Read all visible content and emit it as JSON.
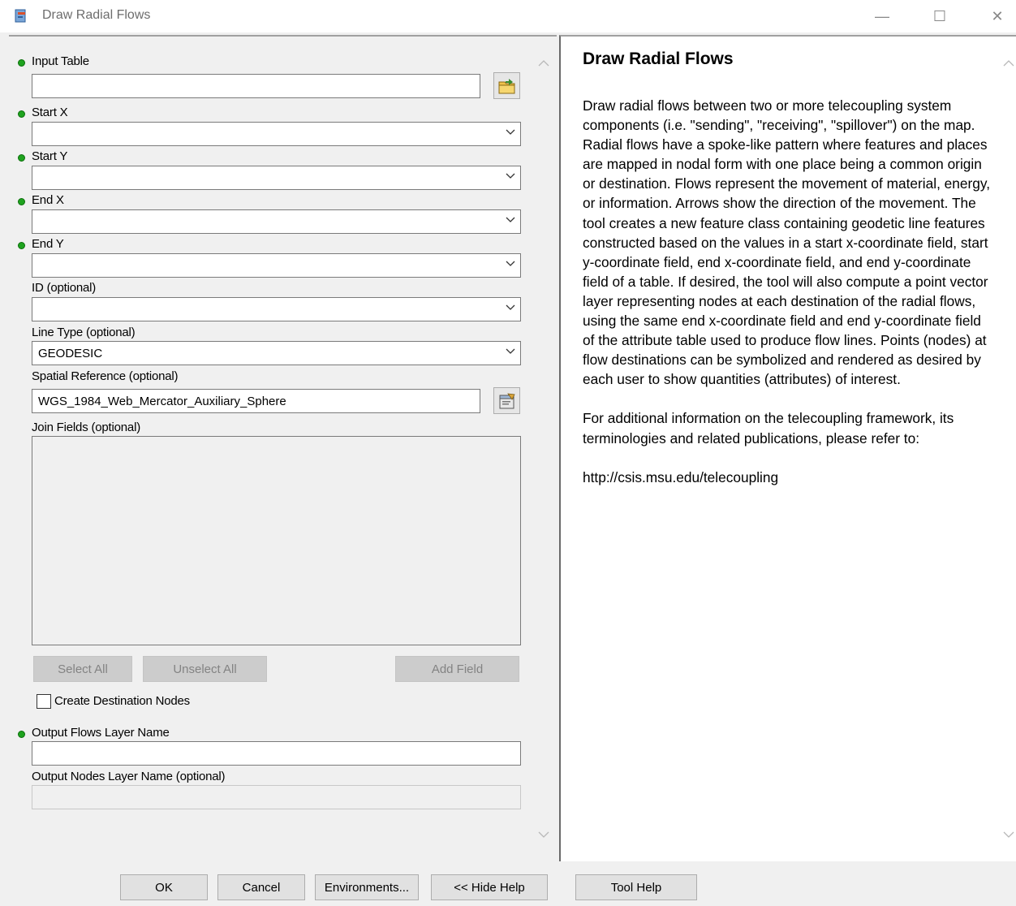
{
  "window": {
    "title": "Draw Radial Flows",
    "minimize_glyph": "—",
    "maximize_glyph": "☐",
    "close_glyph": "✕"
  },
  "form": {
    "input_table": {
      "label": "Input Table",
      "value": ""
    },
    "start_x": {
      "label": "Start X",
      "value": ""
    },
    "start_y": {
      "label": "Start Y",
      "value": ""
    },
    "end_x": {
      "label": "End X",
      "value": ""
    },
    "end_y": {
      "label": "End Y",
      "value": ""
    },
    "id_field": {
      "label": "ID (optional)",
      "value": ""
    },
    "line_type": {
      "label": "Line Type (optional)",
      "value": "GEODESIC"
    },
    "spatial_reference": {
      "label": "Spatial Reference (optional)",
      "value": "WGS_1984_Web_Mercator_Auxiliary_Sphere"
    },
    "join_fields": {
      "label": "Join Fields (optional)"
    },
    "select_all_label": "Select All",
    "unselect_all_label": "Unselect All",
    "add_field_label": "Add Field",
    "create_nodes": {
      "label": "Create Destination Nodes",
      "checked": false
    },
    "output_flows": {
      "label": "Output Flows Layer Name",
      "value": ""
    },
    "output_nodes": {
      "label": "Output Nodes Layer Name (optional)",
      "value": ""
    }
  },
  "help": {
    "title": "Draw Radial Flows",
    "paragraphs": [
      "Draw radial flows between two or more telecoupling system components (i.e. \"sending\", \"receiving\", \"spillover\") on the map. Radial flows have a spoke-like pattern where features and places are mapped in nodal form with one place being a common origin or destination. Flows represent the movement of material, energy, or information. Arrows show the direction of the movement. The tool creates a new feature class containing geodetic line features constructed based on the values in a start x-coordinate field, start y-coordinate field, end x-coordinate field, and end y-coordinate field of a table. If desired, the tool will also compute a point vector layer representing nodes at each destination of the radial flows, using the same end x-coordinate field and end y-coordinate field of the attribute table used to produce flow lines. Points (nodes) at flow destinations can be symbolized and rendered as desired by each user to show quantities (attributes) of interest.",
      "For additional information on the telecoupling framework, its terminologies and related publications, please refer to:",
      "http://csis.msu.edu/telecoupling"
    ]
  },
  "buttons": {
    "ok": "OK",
    "cancel": "Cancel",
    "environments": "Environments...",
    "hide_help": "<< Hide Help",
    "tool_help": "Tool Help"
  },
  "colors": {
    "required_dot": "#1fa31f",
    "disabled_button": "#cccccc",
    "panel_bg": "#f0f0f0"
  },
  "icons": [
    "app-tool-icon",
    "browse-folder-icon",
    "spatial-reference-icon",
    "chevron-down-icon",
    "scroll-up-icon",
    "scroll-down-icon"
  ]
}
